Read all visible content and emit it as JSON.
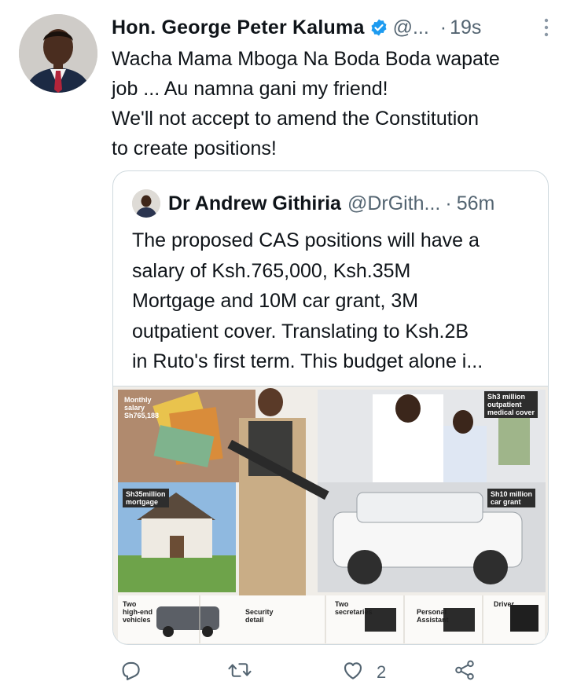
{
  "tweet": {
    "author_name": "Hon. George Peter Kaluma",
    "handle": "@...",
    "separator": "·",
    "time": "19s",
    "text": "Wacha Mama Mboga Na Boda Boda wapate\njob ... Au namna gani my friend!\nWe'll not accept to amend the Constitution\nto create positions!",
    "verified": true,
    "icons": {
      "verified": "verified-badge-icon",
      "more": "more-vertical-icon"
    }
  },
  "quote": {
    "author_name": "Dr Andrew Githiria",
    "handle": "@DrGith...",
    "separator": "·",
    "time": "56m",
    "text": "The proposed CAS positions will have a\nsalary of Ksh.765,000, Ksh.35M\nMortgage and 10M car grant, 3M\noutpatient cover. Translating to Ksh.2B\nin Ruto's first term. This budget alone i...",
    "media": {
      "captions": {
        "monthly_salary": "Monthly\nsalary\nSh765,188",
        "medical": "Sh3 million\noutpatient\nmedical cover",
        "mortgage": "Sh35million\nmortgage",
        "car_grant": "Sh10 million\ncar grant",
        "vehicles": "Two\nhigh-end\nvehicles",
        "security": "Security\ndetail",
        "secretaries": "Two\nsecretaries",
        "assistant": "Personal\nAssistant",
        "driver": "Driver"
      }
    }
  },
  "actions": {
    "reply": {
      "icon": "reply-icon",
      "count": ""
    },
    "retweet": {
      "icon": "retweet-icon",
      "count": ""
    },
    "like": {
      "icon": "heart-icon",
      "count": "2"
    },
    "share": {
      "icon": "share-icon",
      "count": ""
    }
  },
  "colors": {
    "text": "#0f1419",
    "secondary": "#536471",
    "verified": "#1d9bf0",
    "border": "#cfd9de"
  }
}
